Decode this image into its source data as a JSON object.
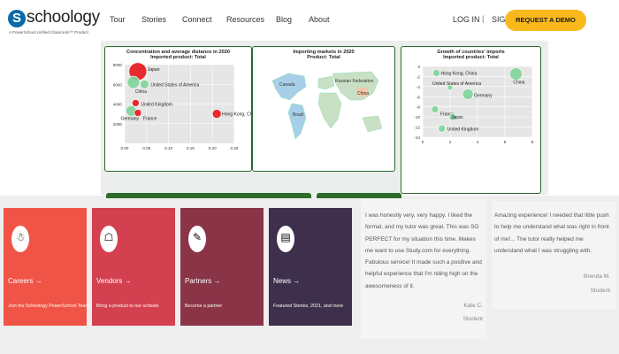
{
  "brand": {
    "name": "schoology",
    "letter": "S",
    "tagline": "A PowerSchool Unified Classroom™ Product"
  },
  "nav": {
    "links": [
      "Tour",
      "Stories",
      "Connect",
      "Resources",
      "Blog",
      "About"
    ],
    "login": "LOG IN",
    "separator": "|",
    "signup": "SIGN UP",
    "demo": "REQUEST A DEMO"
  },
  "colors": {
    "brand_blue": "#0a6aa8",
    "demo_yellow": "#f9b91d",
    "panel_border": "#2d6b2a",
    "bubble_red": "#e8141b",
    "bubble_green": "#7fd49a",
    "map_blue": "#a7cfe8",
    "map_land": "#c9e0c4"
  },
  "charts": {
    "concentration": {
      "title": "Concentration and average distance in 2020",
      "subtitle": "Imported product: Total",
      "y_ticks": [
        "8000",
        "6000",
        "4000",
        "2000"
      ],
      "x_ticks": [
        "0.00",
        "0.05",
        "0.10",
        "0.15",
        "0.20",
        "0.25"
      ],
      "labels": [
        "Japan",
        "United States of America",
        "China",
        "United Kingdom",
        "Hong Kong, China",
        "Germany",
        "France"
      ]
    },
    "map": {
      "title": "Importing markets in 2020",
      "subtitle": "Product: Total",
      "labels": [
        "Canada",
        "Russian Federation",
        "China",
        "Brazil"
      ]
    },
    "growth": {
      "title": "Growth of countries' imports",
      "subtitle": "Imported product: Total",
      "y_ticks": [
        "0",
        "-2",
        "-4",
        "-6",
        "-8",
        "-10",
        "-12",
        "-14"
      ],
      "x_ticks": [
        "0",
        "2",
        "4",
        "6",
        "8"
      ],
      "labels": [
        "Hong Kong, China",
        "United States of America",
        "Germany",
        "China",
        "France",
        "Japan",
        "United Kingdom"
      ]
    }
  },
  "chart_data": [
    {
      "type": "scatter",
      "title": "Concentration and average distance in 2020",
      "subtitle": "Imported product: Total",
      "xlim": [
        0,
        0.25
      ],
      "ylim": [
        0,
        8000
      ],
      "series": [
        {
          "name": "Japan",
          "x": 0.03,
          "y": 7300
        },
        {
          "name": "United States of America",
          "x": 0.045,
          "y": 6000
        },
        {
          "name": "China",
          "x": 0.02,
          "y": 6200
        },
        {
          "name": "United Kingdom",
          "x": 0.025,
          "y": 4100
        },
        {
          "name": "Hong Kong, China",
          "x": 0.21,
          "y": 3000
        },
        {
          "name": "Germany",
          "x": 0.015,
          "y": 3300
        },
        {
          "name": "France",
          "x": 0.03,
          "y": 3100
        }
      ]
    },
    {
      "type": "scatter",
      "title": "Growth of countries' imports",
      "subtitle": "Imported product: Total",
      "xlim": [
        0,
        8
      ],
      "ylim": [
        -14,
        0
      ],
      "series": [
        {
          "name": "Hong Kong, China",
          "x": 1,
          "y": -1.3
        },
        {
          "name": "United States of America",
          "x": 2,
          "y": -4.2
        },
        {
          "name": "Germany",
          "x": 3.3,
          "y": -5.5
        },
        {
          "name": "China",
          "x": 6.8,
          "y": -1.5
        },
        {
          "name": "France",
          "x": 0.9,
          "y": -8.5
        },
        {
          "name": "Japan",
          "x": 2.2,
          "y": -10
        },
        {
          "name": "United Kingdom",
          "x": 1.4,
          "y": -12.3
        }
      ]
    }
  ],
  "tiles": [
    {
      "title": "Careers →",
      "desc": "Join the Schoology PowerSchool Team",
      "color": "#f05447",
      "glyph": "☃"
    },
    {
      "title": "Vendors →",
      "desc": "Bring a product to our schools",
      "color": "#d34150",
      "glyph": "☖"
    },
    {
      "title": "Partners →",
      "desc": "Become a partner",
      "color": "#8a3448",
      "glyph": "✎"
    },
    {
      "title": "News →",
      "desc": "Featured Stories, 2021, and more",
      "color": "#3e2f4c",
      "glyph": "▤"
    }
  ],
  "testimonials": [
    {
      "text": "I was honestly very, very happy. I liked the format, and my tutor was great. This was SO PERFECT for my situation this time. Makes me want to use Study.com for everything. Fabulous service! It made such a positive and helpful experience that I'm riding high on the awesomeness of it.",
      "name": "Kate C.",
      "role": "Student"
    },
    {
      "text": "Amazing experience! I needed that little push to help me understand what was right in front of me!... The tutor really helped me understand what I was struggling with.",
      "name": "Brenda M.",
      "role": "Student"
    }
  ]
}
